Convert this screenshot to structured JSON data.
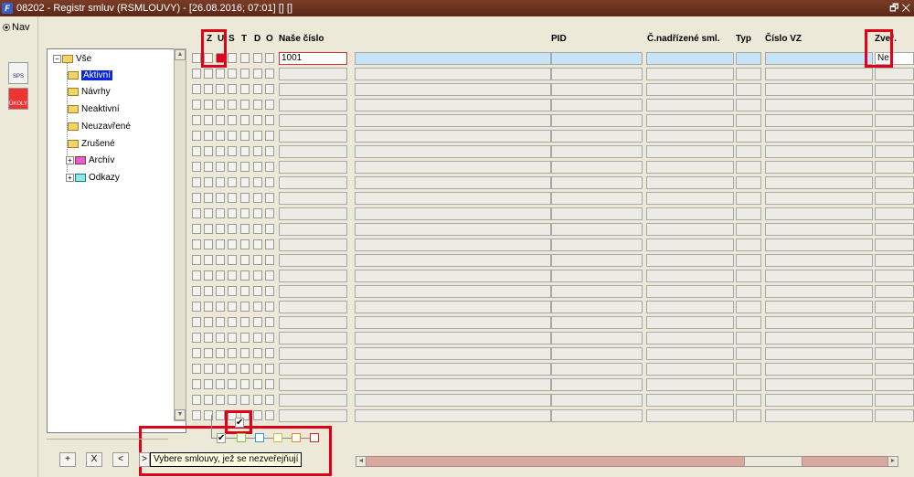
{
  "window": {
    "title": "08202 - Registr smluv (RSMLOUVY) - [26.08.2016; 07:01] [] []",
    "app_icon": "F",
    "window_buttons": "🗗 ✕"
  },
  "left": {
    "nav_label": "Nav",
    "sps_label": "SPS",
    "ukoly_label": "ÚKOLY"
  },
  "tree": {
    "root": "Vše",
    "items": [
      "Aktivní",
      "Návrhy",
      "Neaktivní",
      "Neuzavřené",
      "Zrušené",
      "Archív",
      "Odkazy"
    ]
  },
  "grid": {
    "flag_headers": [
      "Z",
      "U",
      "S",
      "T",
      "D",
      "O"
    ],
    "columns": {
      "nase_cislo": "Naše číslo",
      "pid": "PID",
      "nadrizene": "Č.nadřízené sml.",
      "typ": "Typ",
      "cislo_vz": "Číslo VZ",
      "zver": "Zveř."
    },
    "first_row": {
      "nase_cislo": "1001",
      "zver": "Ne"
    }
  },
  "bottom": {
    "btn_add": "+",
    "btn_delete": "X",
    "btn_prev": "<",
    "btn_next": ">",
    "tooltip": "Vybere smlouvy, jež se nezveřejňují"
  },
  "colors": {
    "title_bar": "#6b3120",
    "selection": "#0a24d8",
    "highlight_row": "#c7e3f7",
    "annotation_red": "#e0001a"
  }
}
